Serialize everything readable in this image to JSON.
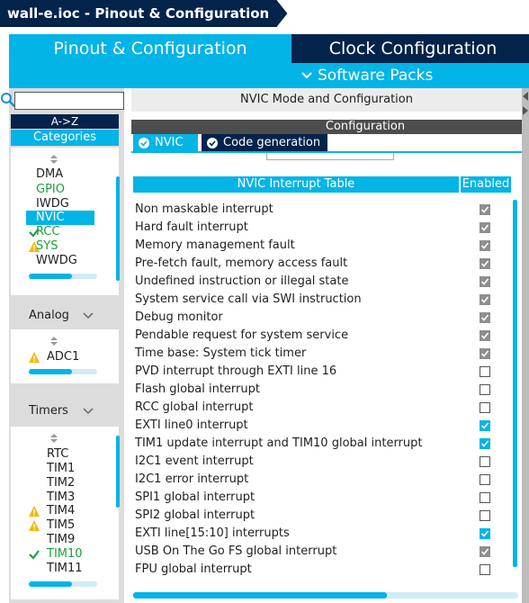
{
  "window": {
    "title": "wall-e.ioc - Pinout & Configuration"
  },
  "tabs": {
    "pinout": "Pinout & Configuration",
    "clock": "Clock Configuration",
    "software_packs": "Software Packs"
  },
  "sidebar": {
    "search_value": "",
    "sort_label": "A->Z",
    "categories_label": "Categories",
    "system_items": [
      {
        "label": "DMA",
        "state": "none"
      },
      {
        "label": "GPIO",
        "state": "green"
      },
      {
        "label": "IWDG",
        "state": "none"
      },
      {
        "label": "NVIC",
        "state": "selected"
      },
      {
        "label": "RCC",
        "state": "check"
      },
      {
        "label": "SYS",
        "state": "warning"
      },
      {
        "label": "WWDG",
        "state": "none"
      }
    ],
    "analog_label": "Analog",
    "analog_items": [
      {
        "label": "ADC1",
        "state": "warning"
      }
    ],
    "timers_label": "Timers",
    "timer_items": [
      {
        "label": "RTC",
        "state": "none"
      },
      {
        "label": "TIM1",
        "state": "none"
      },
      {
        "label": "TIM2",
        "state": "none"
      },
      {
        "label": "TIM3",
        "state": "none"
      },
      {
        "label": "TIM4",
        "state": "warning"
      },
      {
        "label": "TIM5",
        "state": "warning"
      },
      {
        "label": "TIM9",
        "state": "none"
      },
      {
        "label": "TIM10",
        "state": "check"
      },
      {
        "label": "TIM11",
        "state": "none"
      }
    ]
  },
  "main": {
    "header": "NVIC Mode and Configuration",
    "config_label": "Configuration",
    "subtabs": {
      "nvic": "NVIC",
      "code": "Code generation"
    },
    "table": {
      "col_name": "NVIC Interrupt Table",
      "col_enabled": "Enabled",
      "rows": [
        {
          "name": "Non maskable interrupt",
          "enabled": true,
          "locked": true
        },
        {
          "name": "Hard fault interrupt",
          "enabled": true,
          "locked": true
        },
        {
          "name": "Memory management fault",
          "enabled": true,
          "locked": true
        },
        {
          "name": "Pre-fetch fault, memory access fault",
          "enabled": true,
          "locked": true
        },
        {
          "name": "Undefined instruction or illegal state",
          "enabled": true,
          "locked": true
        },
        {
          "name": "System service call via SWI instruction",
          "enabled": true,
          "locked": true
        },
        {
          "name": "Debug monitor",
          "enabled": true,
          "locked": true
        },
        {
          "name": "Pendable request for system service",
          "enabled": true,
          "locked": true
        },
        {
          "name": "Time base: System tick timer",
          "enabled": true,
          "locked": true
        },
        {
          "name": "PVD interrupt through EXTI line 16",
          "enabled": false,
          "locked": false
        },
        {
          "name": "Flash global interrupt",
          "enabled": false,
          "locked": false
        },
        {
          "name": "RCC global interrupt",
          "enabled": false,
          "locked": false
        },
        {
          "name": "EXTI line0 interrupt",
          "enabled": true,
          "locked": false
        },
        {
          "name": "TIM1 update interrupt and TIM10 global interrupt",
          "enabled": true,
          "locked": false
        },
        {
          "name": "I2C1 event interrupt",
          "enabled": false,
          "locked": false
        },
        {
          "name": "I2C1 error interrupt",
          "enabled": false,
          "locked": false
        },
        {
          "name": "SPI1 global interrupt",
          "enabled": false,
          "locked": false
        },
        {
          "name": "SPI2 global interrupt",
          "enabled": false,
          "locked": false
        },
        {
          "name": "EXTI line[15:10] interrupts",
          "enabled": true,
          "locked": false
        },
        {
          "name": "USB On The Go FS global interrupt",
          "enabled": true,
          "locked": true
        },
        {
          "name": "FPU global interrupt",
          "enabled": false,
          "locked": false
        }
      ]
    }
  },
  "colors": {
    "accent": "#03b4e6",
    "navy": "#03234b",
    "ok_green": "#1aa33a",
    "warning": "#f5b800",
    "locked_grey": "#8e8e8e"
  }
}
